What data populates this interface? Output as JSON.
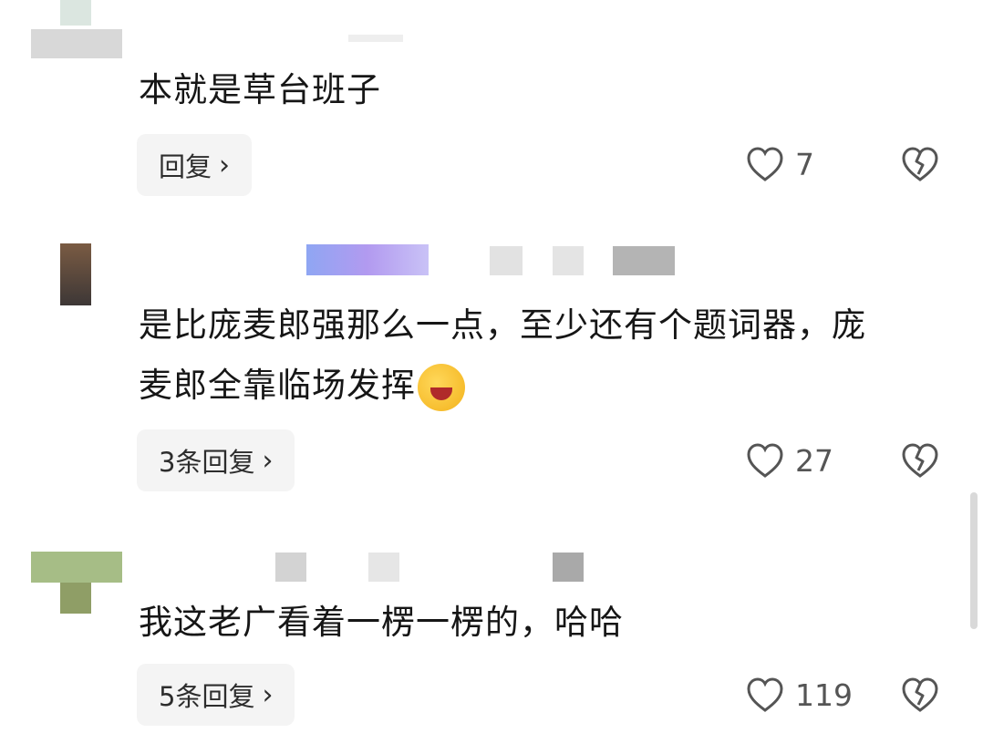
{
  "comments": [
    {
      "text": "本就是草台班子",
      "reply_label": "回复",
      "likes": "7"
    },
    {
      "text": "是比庞麦郎强那么一点，至少还有个题词器，庞麦郎全靠临场发挥",
      "emoji_icon": "rolling-laughing-emoji-icon",
      "reply_label": "3条回复",
      "likes": "27"
    },
    {
      "text": "我这老广看着一楞一楞的，哈哈",
      "reply_label": "5条回复",
      "likes": "119"
    }
  ],
  "icons": {
    "reply_chevron": "chevron-right-icon",
    "like": "heart-outline-icon",
    "dislike": "broken-heart-icon"
  },
  "colors": {
    "background": "#ffffff",
    "reply_bg": "#f4f4f4",
    "text": "#161616",
    "muted": "#555555"
  }
}
